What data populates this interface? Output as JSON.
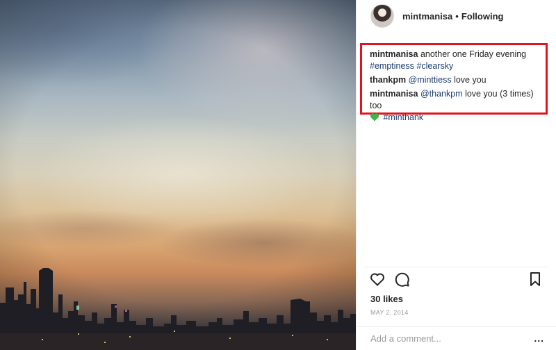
{
  "post": {
    "author": {
      "username": "mintmanisa",
      "separator": "•",
      "follow_label": "Following"
    },
    "comments": [
      {
        "user": "mintmanisa",
        "text": "another one Friday evening",
        "tags": [
          "#emptiness",
          "#clearsky"
        ]
      },
      {
        "user": "thankpm",
        "mention": "@minttiess",
        "text": "love you"
      },
      {
        "user": "mintmanisa",
        "mention": "@thankpm",
        "text": "love you (3 times) too",
        "emoji": "green-heart",
        "tag": "#minthank"
      }
    ],
    "likes": "30 likes",
    "date": "MAY 2, 2014",
    "comment_placeholder": "Add a comment...",
    "more_label": "..."
  },
  "colors": {
    "highlight_border": "#e0141e",
    "tag": "#1c3d6e",
    "green_heart": "#3fb34f",
    "muted": "#999999"
  },
  "icons": [
    "heart-icon",
    "comment-icon",
    "bookmark-icon",
    "green-heart-icon",
    "more-icon"
  ]
}
